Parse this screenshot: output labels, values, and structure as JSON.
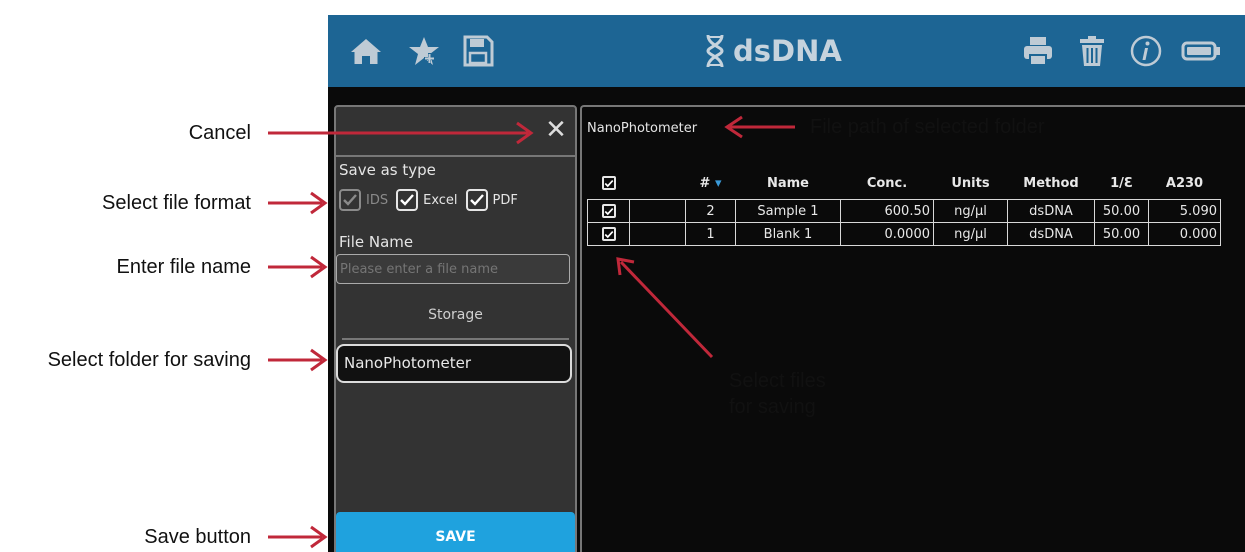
{
  "annotations": {
    "cancel": "Cancel",
    "select_format": "Select file format",
    "enter_name": "Enter file name",
    "select_folder": "Select folder for saving",
    "save_button": "Save button",
    "file_path": "File path of selected folder",
    "select_files_line1": "Select files",
    "select_files_line2": "for saving",
    "arrow_color": "#c0283a"
  },
  "header": {
    "title": "dsDNA",
    "bg_color": "#1d6594",
    "icon_color": "#bfcbd5",
    "icons_left": [
      "home-icon",
      "favorite-star-icon",
      "save-disk-icon"
    ],
    "icons_right": [
      "print-icon",
      "trash-icon",
      "info-icon",
      "battery-icon"
    ],
    "title_icon": "dna-icon"
  },
  "save_panel": {
    "close_glyph": "✕",
    "save_as_type_label": "Save as type",
    "formats": [
      {
        "label": "IDS",
        "checked": true,
        "disabled": true
      },
      {
        "label": "Excel",
        "checked": true,
        "disabled": false
      },
      {
        "label": "PDF",
        "checked": true,
        "disabled": false
      }
    ],
    "file_name_label": "File Name",
    "file_name_placeholder": "Please enter a file name",
    "storage_label": "Storage",
    "folder": "NanoPhotometer",
    "save_label": "SAVE",
    "save_color": "#1fa2de"
  },
  "results": {
    "folder_path": "NanoPhotometer",
    "columns": [
      "#",
      "Name",
      "Conc.",
      "Units",
      "Method",
      "1/Ɛ",
      "A230"
    ],
    "sort_indicator": "▾",
    "rows": [
      {
        "checked": true,
        "num": "2",
        "name": "Sample 1",
        "conc": "600.50",
        "units": "ng/µl",
        "method": "dsDNA",
        "inv_eps": "50.00",
        "a230": "5.090"
      },
      {
        "checked": true,
        "num": "1",
        "name": "Blank 1",
        "conc": "0.0000",
        "units": "ng/µl",
        "method": "dsDNA",
        "inv_eps": "50.00",
        "a230": "0.000"
      }
    ]
  }
}
